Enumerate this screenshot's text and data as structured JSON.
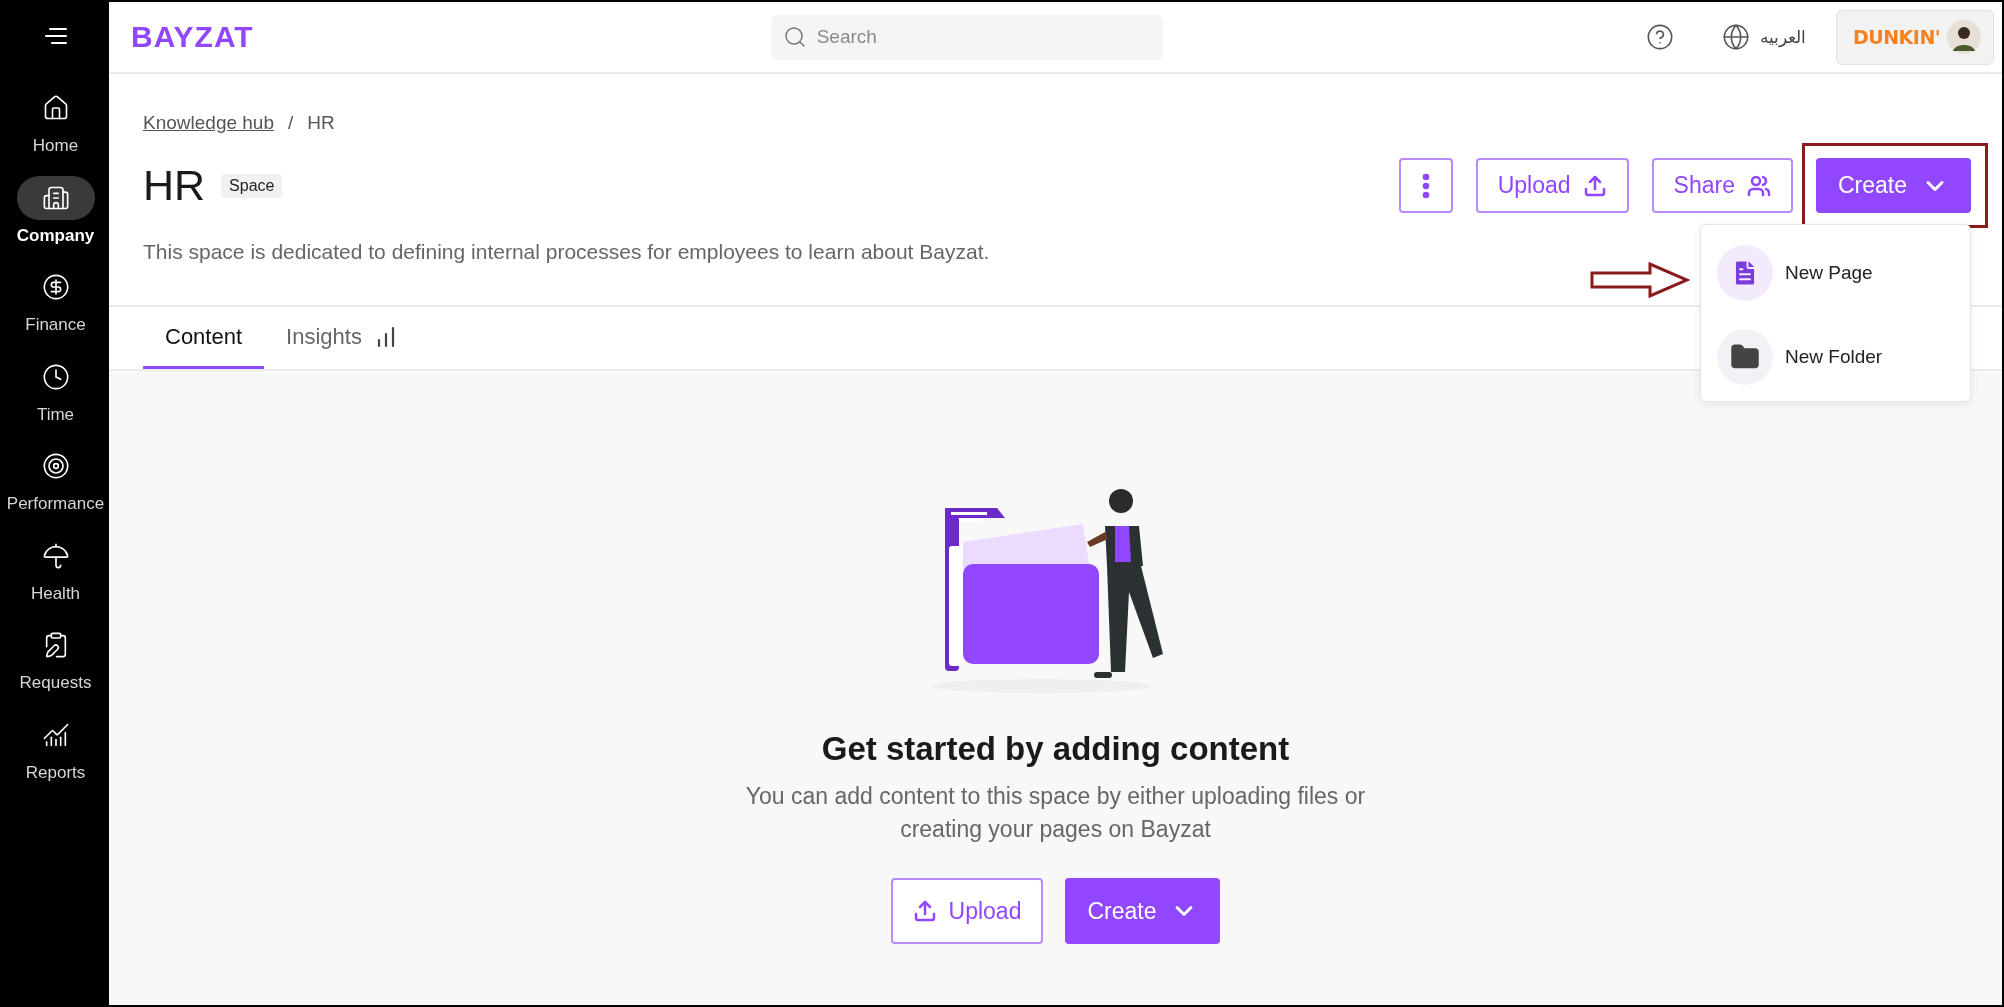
{
  "sidebar": {
    "items": [
      {
        "label": "Home",
        "selected": false
      },
      {
        "label": "Company",
        "selected": true
      },
      {
        "label": "Finance",
        "selected": false
      },
      {
        "label": "Time",
        "selected": false
      },
      {
        "label": "Performance",
        "selected": false
      },
      {
        "label": "Health",
        "selected": false
      },
      {
        "label": "Requests",
        "selected": false
      },
      {
        "label": "Reports",
        "selected": false
      }
    ]
  },
  "top_bar": {
    "logo": "BAYZAT",
    "search": {
      "placeholder": "Search"
    },
    "language": "العربيه",
    "company_logo": "DUNKIN'"
  },
  "breadcrumb": {
    "items": [
      "Knowledge hub",
      "HR"
    ],
    "separator": "/"
  },
  "page": {
    "title": "HR",
    "badge": "Space",
    "description": "This space is dedicated to defining internal processes for employees to learn about Bayzat."
  },
  "actions": {
    "upload": "Upload",
    "share": "Share",
    "create": "Create",
    "create_highlighted": true
  },
  "create_menu": {
    "open": true,
    "items": [
      {
        "label": "New Page",
        "pointed": true
      },
      {
        "label": "New Folder",
        "pointed": false
      }
    ]
  },
  "tabs": [
    {
      "label": "Content",
      "selected": true
    },
    {
      "label": "Insights",
      "selected": false
    }
  ],
  "empty_state": {
    "heading": "Get started by adding content",
    "text": "You can add content to this space by either uploading files or creating your pages on Bayzat",
    "upload": "Upload",
    "create": "Create"
  }
}
